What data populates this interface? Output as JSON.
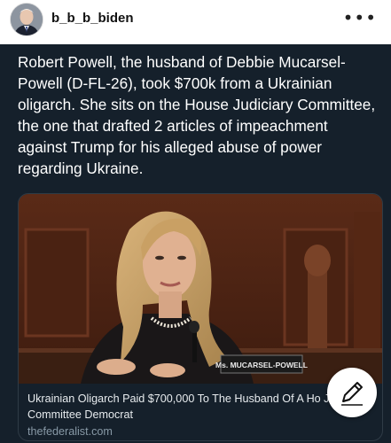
{
  "profile": {
    "username": "b_b_b_biden",
    "more_icon": "ellipsis-icon"
  },
  "post": {
    "text": "Robert Powell, the husband of Debbie Mucarsel-Powell (D-FL-26), took $700k from a Ukrainian oligarch. She sits on the House Judiciary Committee, the one that drafted 2 articles of impeachment against Trump for his alleged abuse of power regarding Ukraine.",
    "card": {
      "nameplate": "Ms. MUCARSEL-POWELL",
      "title": "Ukrainian Oligarch Paid $700,000 To The Husband Of A Ho Judiciary Committee Democrat",
      "domain": "thefederalist.com"
    }
  },
  "compose_button": {
    "icon": "pencil-icon"
  },
  "colors": {
    "post_bg": "#15202b",
    "text": "#ffffff",
    "domain_text": "#8899a6"
  }
}
